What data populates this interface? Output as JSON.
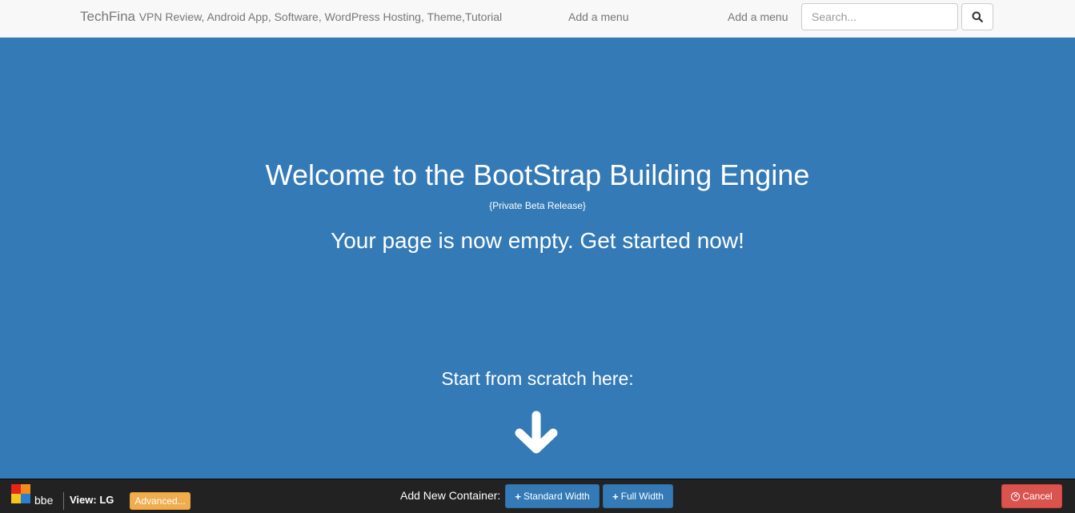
{
  "navbar": {
    "brand": "TechFina",
    "tagline": "VPN Review, Android App, Software, WordPress Hosting, Theme,Tutorial",
    "menu_links": [
      "Add a menu",
      "Add a menu"
    ],
    "search": {
      "placeholder": "Search...",
      "value": ""
    },
    "search_icon": "search-icon"
  },
  "hero": {
    "title": "Welcome to the BootStrap Building Engine",
    "subtitle": "{Private Beta Release}",
    "lead": "Your page is now empty. Get started now!",
    "scratch_label": "Start from scratch here:",
    "arrow_icon": "arrow-down-icon"
  },
  "toolbar": {
    "logo_name": "bbe",
    "view_label": "View: LG",
    "advanced_label": "Advanced...",
    "add_container_label": "Add New Container:",
    "standard_width_label": "Standard Width",
    "full_width_label": "Full Width",
    "cancel_label": "Cancel"
  },
  "colors": {
    "hero_background": "#337ab7",
    "navbar_background": "#f8f8f8",
    "toolbar_background": "#222222",
    "advanced_button": "#f0ad4e",
    "primary_button": "#337ab7",
    "cancel_button": "#d9534f",
    "logo_red": "#e8231a",
    "logo_orange": "#f28c1b",
    "logo_yellow": "#f5c61a",
    "logo_blue": "#2a7fd1"
  }
}
